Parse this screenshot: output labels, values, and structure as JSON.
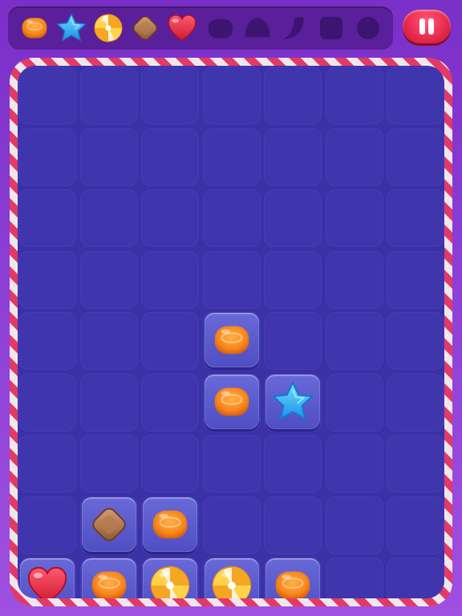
{
  "top_bar": {
    "target_candies": [
      {
        "candy": "orange-jelly-candy",
        "state": "collected"
      },
      {
        "candy": "blue-star-candy",
        "state": "collected"
      },
      {
        "candy": "swirl-lollipop-candy",
        "state": "collected"
      },
      {
        "candy": "caramel-diamond-candy",
        "state": "collected"
      },
      {
        "candy": "red-heart-candy",
        "state": "collected"
      },
      {
        "candy": "rounded-blob-silhouette",
        "state": "empty"
      },
      {
        "candy": "dome-silhouette",
        "state": "empty"
      },
      {
        "candy": "crescent-silhouette",
        "state": "empty"
      },
      {
        "candy": "rounded-square-silhouette",
        "state": "empty"
      },
      {
        "candy": "circle-silhouette",
        "state": "empty"
      }
    ],
    "pause_button": "pause-icon"
  },
  "board": {
    "columns": 7,
    "rows": 9,
    "pieces": [
      {
        "row": 4,
        "col": 3,
        "candy": "orange-jelly-candy"
      },
      {
        "row": 5,
        "col": 3,
        "candy": "orange-jelly-candy"
      },
      {
        "row": 5,
        "col": 4,
        "candy": "blue-star-candy"
      },
      {
        "row": 7,
        "col": 1,
        "candy": "caramel-diamond-candy"
      },
      {
        "row": 7,
        "col": 2,
        "candy": "orange-jelly-candy"
      },
      {
        "row": 8,
        "col": 0,
        "candy": "red-heart-candy"
      },
      {
        "row": 8,
        "col": 1,
        "candy": "orange-jelly-candy"
      },
      {
        "row": 8,
        "col": 2,
        "candy": "swirl-lollipop-candy"
      },
      {
        "row": 8,
        "col": 3,
        "candy": "swirl-lollipop-candy"
      },
      {
        "row": 8,
        "col": 4,
        "candy": "orange-jelly-candy"
      }
    ]
  },
  "colors": {
    "background": "#8b3fd6",
    "board": "#3a31a6",
    "frame_stripe": "#e23a66",
    "pause_button": "#e8284a"
  }
}
